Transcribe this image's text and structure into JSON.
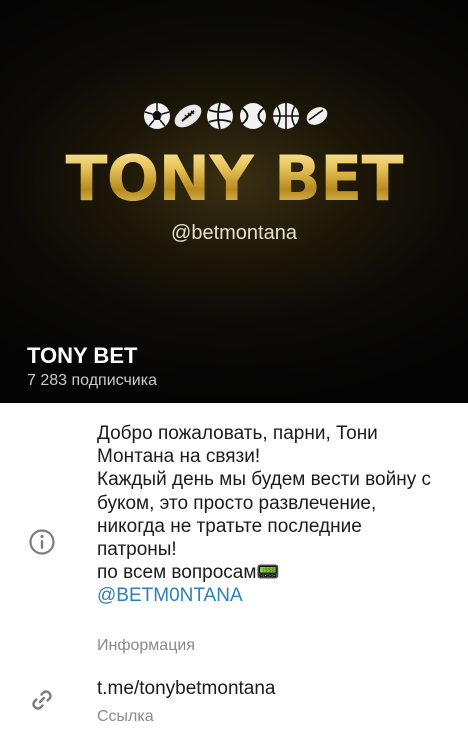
{
  "cover": {
    "logo_title": "TONY BET",
    "logo_handle": "@betmontana",
    "sport_icons": [
      "soccer-ball-icon",
      "american-football-icon",
      "volleyball-icon",
      "tennis-ball-icon",
      "basketball-icon",
      "hockey-puck-icon"
    ]
  },
  "channel": {
    "name": "TONY BET",
    "subscribers": "7 283 подписчика"
  },
  "info": {
    "description": "Добро пожаловать, парни, Тони Монтана на связи!\nКаждый день мы будем вести войну с буком, это просто развлечение, никогда не тратьте последние патроны!\nпо всем вопросам",
    "emoji": "📟",
    "mention": "@BETM0NTANA",
    "label": "Информация",
    "icon": "info-icon"
  },
  "link": {
    "url": "t.me/tonybetmontana",
    "label": "Ссылка",
    "icon": "link-icon"
  },
  "colors": {
    "gold": "#d4b24a",
    "mention": "#2f7fb8",
    "secondary_text": "#8a8a8a"
  }
}
